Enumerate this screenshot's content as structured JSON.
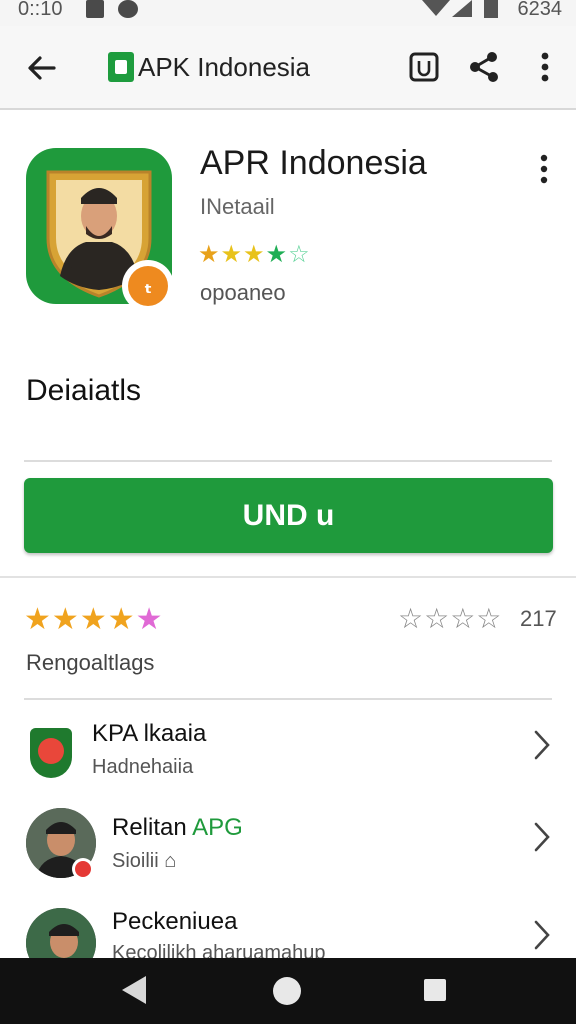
{
  "status_bar": {
    "time": "0::10",
    "right_text": "6234"
  },
  "app_bar": {
    "title": "APK Indonesia",
    "icons": [
      "back-arrow-icon",
      "apk-logo-icon",
      "square-icon",
      "share-icon",
      "more-vert-icon"
    ]
  },
  "app": {
    "name": "APR Indonesia",
    "developer": "INetaail",
    "stars": [
      "★",
      "★",
      "★",
      "★",
      "☆"
    ],
    "star_colors": [
      "#e8a21b",
      "#e8c21b",
      "#e8c21b",
      "#1fae55",
      "#5fd39a"
    ],
    "downloads": "opoanео",
    "badge_text": "ₜ"
  },
  "section": {
    "title": "Deiaiatls"
  },
  "install_button": {
    "label": "UND u"
  },
  "rating": {
    "filled_stars": [
      "★",
      "★",
      "★",
      "★",
      "★"
    ],
    "filled_colors": [
      "#f0a31e",
      "#f0a31e",
      "#f0a31e",
      "#f0a31e",
      "#e06ad5"
    ],
    "empty_stars": "☆☆☆☆",
    "count": "217",
    "label": "Rengoaltlags"
  },
  "list": [
    {
      "title": "KPA lkaaia",
      "title_accent": "",
      "subtitle": "Hadnehaiia",
      "icon": "shield-app-icon"
    },
    {
      "title": "Relitan ",
      "title_accent": "APG",
      "subtitle": "Sioilii ⌂",
      "icon": "avatar-icon"
    },
    {
      "title": "Peckeniuea",
      "title_accent": "",
      "subtitle": "Kecolilikh aharuamahup",
      "icon": "avatar-icon"
    }
  ],
  "colors": {
    "brand_green": "#1f9a3c",
    "badge_orange": "#ee8a1f",
    "nav_bar": "#111111"
  }
}
